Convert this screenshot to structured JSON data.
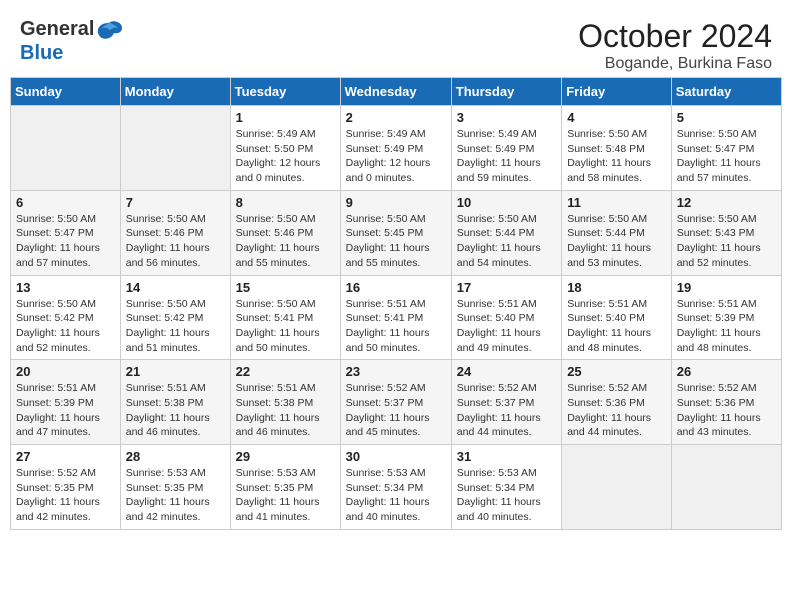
{
  "header": {
    "logo_general": "General",
    "logo_blue": "Blue",
    "month_title": "October 2024",
    "subtitle": "Bogande, Burkina Faso"
  },
  "days_of_week": [
    "Sunday",
    "Monday",
    "Tuesday",
    "Wednesday",
    "Thursday",
    "Friday",
    "Saturday"
  ],
  "weeks": [
    [
      {
        "day": "",
        "sunrise": "",
        "sunset": "",
        "daylight": ""
      },
      {
        "day": "",
        "sunrise": "",
        "sunset": "",
        "daylight": ""
      },
      {
        "day": "1",
        "sunrise": "Sunrise: 5:49 AM",
        "sunset": "Sunset: 5:50 PM",
        "daylight": "Daylight: 12 hours and 0 minutes."
      },
      {
        "day": "2",
        "sunrise": "Sunrise: 5:49 AM",
        "sunset": "Sunset: 5:49 PM",
        "daylight": "Daylight: 12 hours and 0 minutes."
      },
      {
        "day": "3",
        "sunrise": "Sunrise: 5:49 AM",
        "sunset": "Sunset: 5:49 PM",
        "daylight": "Daylight: 11 hours and 59 minutes."
      },
      {
        "day": "4",
        "sunrise": "Sunrise: 5:50 AM",
        "sunset": "Sunset: 5:48 PM",
        "daylight": "Daylight: 11 hours and 58 minutes."
      },
      {
        "day": "5",
        "sunrise": "Sunrise: 5:50 AM",
        "sunset": "Sunset: 5:47 PM",
        "daylight": "Daylight: 11 hours and 57 minutes."
      }
    ],
    [
      {
        "day": "6",
        "sunrise": "Sunrise: 5:50 AM",
        "sunset": "Sunset: 5:47 PM",
        "daylight": "Daylight: 11 hours and 57 minutes."
      },
      {
        "day": "7",
        "sunrise": "Sunrise: 5:50 AM",
        "sunset": "Sunset: 5:46 PM",
        "daylight": "Daylight: 11 hours and 56 minutes."
      },
      {
        "day": "8",
        "sunrise": "Sunrise: 5:50 AM",
        "sunset": "Sunset: 5:46 PM",
        "daylight": "Daylight: 11 hours and 55 minutes."
      },
      {
        "day": "9",
        "sunrise": "Sunrise: 5:50 AM",
        "sunset": "Sunset: 5:45 PM",
        "daylight": "Daylight: 11 hours and 55 minutes."
      },
      {
        "day": "10",
        "sunrise": "Sunrise: 5:50 AM",
        "sunset": "Sunset: 5:44 PM",
        "daylight": "Daylight: 11 hours and 54 minutes."
      },
      {
        "day": "11",
        "sunrise": "Sunrise: 5:50 AM",
        "sunset": "Sunset: 5:44 PM",
        "daylight": "Daylight: 11 hours and 53 minutes."
      },
      {
        "day": "12",
        "sunrise": "Sunrise: 5:50 AM",
        "sunset": "Sunset: 5:43 PM",
        "daylight": "Daylight: 11 hours and 52 minutes."
      }
    ],
    [
      {
        "day": "13",
        "sunrise": "Sunrise: 5:50 AM",
        "sunset": "Sunset: 5:42 PM",
        "daylight": "Daylight: 11 hours and 52 minutes."
      },
      {
        "day": "14",
        "sunrise": "Sunrise: 5:50 AM",
        "sunset": "Sunset: 5:42 PM",
        "daylight": "Daylight: 11 hours and 51 minutes."
      },
      {
        "day": "15",
        "sunrise": "Sunrise: 5:50 AM",
        "sunset": "Sunset: 5:41 PM",
        "daylight": "Daylight: 11 hours and 50 minutes."
      },
      {
        "day": "16",
        "sunrise": "Sunrise: 5:51 AM",
        "sunset": "Sunset: 5:41 PM",
        "daylight": "Daylight: 11 hours and 50 minutes."
      },
      {
        "day": "17",
        "sunrise": "Sunrise: 5:51 AM",
        "sunset": "Sunset: 5:40 PM",
        "daylight": "Daylight: 11 hours and 49 minutes."
      },
      {
        "day": "18",
        "sunrise": "Sunrise: 5:51 AM",
        "sunset": "Sunset: 5:40 PM",
        "daylight": "Daylight: 11 hours and 48 minutes."
      },
      {
        "day": "19",
        "sunrise": "Sunrise: 5:51 AM",
        "sunset": "Sunset: 5:39 PM",
        "daylight": "Daylight: 11 hours and 48 minutes."
      }
    ],
    [
      {
        "day": "20",
        "sunrise": "Sunrise: 5:51 AM",
        "sunset": "Sunset: 5:39 PM",
        "daylight": "Daylight: 11 hours and 47 minutes."
      },
      {
        "day": "21",
        "sunrise": "Sunrise: 5:51 AM",
        "sunset": "Sunset: 5:38 PM",
        "daylight": "Daylight: 11 hours and 46 minutes."
      },
      {
        "day": "22",
        "sunrise": "Sunrise: 5:51 AM",
        "sunset": "Sunset: 5:38 PM",
        "daylight": "Daylight: 11 hours and 46 minutes."
      },
      {
        "day": "23",
        "sunrise": "Sunrise: 5:52 AM",
        "sunset": "Sunset: 5:37 PM",
        "daylight": "Daylight: 11 hours and 45 minutes."
      },
      {
        "day": "24",
        "sunrise": "Sunrise: 5:52 AM",
        "sunset": "Sunset: 5:37 PM",
        "daylight": "Daylight: 11 hours and 44 minutes."
      },
      {
        "day": "25",
        "sunrise": "Sunrise: 5:52 AM",
        "sunset": "Sunset: 5:36 PM",
        "daylight": "Daylight: 11 hours and 44 minutes."
      },
      {
        "day": "26",
        "sunrise": "Sunrise: 5:52 AM",
        "sunset": "Sunset: 5:36 PM",
        "daylight": "Daylight: 11 hours and 43 minutes."
      }
    ],
    [
      {
        "day": "27",
        "sunrise": "Sunrise: 5:52 AM",
        "sunset": "Sunset: 5:35 PM",
        "daylight": "Daylight: 11 hours and 42 minutes."
      },
      {
        "day": "28",
        "sunrise": "Sunrise: 5:53 AM",
        "sunset": "Sunset: 5:35 PM",
        "daylight": "Daylight: 11 hours and 42 minutes."
      },
      {
        "day": "29",
        "sunrise": "Sunrise: 5:53 AM",
        "sunset": "Sunset: 5:35 PM",
        "daylight": "Daylight: 11 hours and 41 minutes."
      },
      {
        "day": "30",
        "sunrise": "Sunrise: 5:53 AM",
        "sunset": "Sunset: 5:34 PM",
        "daylight": "Daylight: 11 hours and 40 minutes."
      },
      {
        "day": "31",
        "sunrise": "Sunrise: 5:53 AM",
        "sunset": "Sunset: 5:34 PM",
        "daylight": "Daylight: 11 hours and 40 minutes."
      },
      {
        "day": "",
        "sunrise": "",
        "sunset": "",
        "daylight": ""
      },
      {
        "day": "",
        "sunrise": "",
        "sunset": "",
        "daylight": ""
      }
    ]
  ]
}
